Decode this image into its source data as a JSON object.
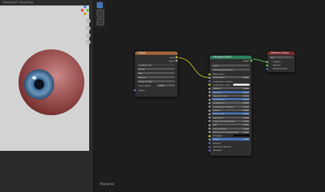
{
  "viewport": {
    "label": "Viewport Shading"
  },
  "image_node": {
    "title": "Image",
    "outputs": [
      "Color",
      "Alpha"
    ],
    "image_name": "ey_Basic_Iris.",
    "interpolation": "Linear",
    "projection": "Flat",
    "extension": "Repeat",
    "source": "Single Image",
    "color_space_label": "Color Space",
    "color_space": "sRGB",
    "vector_label": "Vector"
  },
  "bsdf_node": {
    "title": "Principled BSDF",
    "output": "BSDF",
    "distribution": "GGX",
    "subsurface_method": "Christensen-Burley",
    "inputs": [
      {
        "label": "Base Color"
      },
      {
        "label": "Subsurface",
        "value": "0.000"
      },
      {
        "label": "Subsurface Radius"
      },
      {
        "label": "Subsurface Color"
      },
      {
        "label": "Metallic",
        "value": "0.000"
      },
      {
        "label": "Specular",
        "value": "0.500",
        "highlight": true
      },
      {
        "label": "Specular Tint",
        "value": "0.000"
      },
      {
        "label": "Roughness",
        "value": "0.500",
        "highlight": true
      },
      {
        "label": "Anisotropic",
        "value": "0.000"
      },
      {
        "label": "Anisotropic Rotation",
        "value": "0.000"
      },
      {
        "label": "Sheen",
        "value": "0.000"
      },
      {
        "label": "Sheen Tint",
        "value": "0.500",
        "highlight": true
      },
      {
        "label": "Clearcoat",
        "value": "0.000"
      },
      {
        "label": "Clearcoat Roughness",
        "value": "0.030"
      },
      {
        "label": "IOR",
        "value": "1.450"
      },
      {
        "label": "Transmission",
        "value": "0.000"
      },
      {
        "label": "Transmission Roughness",
        "value": "0.000"
      },
      {
        "label": "Emission"
      },
      {
        "label": "Alpha",
        "value": "1.000",
        "highlight": true
      },
      {
        "label": "Normal"
      },
      {
        "label": "Clearcoat Normal"
      },
      {
        "label": "Tangent"
      }
    ]
  },
  "output_node": {
    "title": "Material Output",
    "target": "All",
    "inputs": [
      "Surface",
      "Volume",
      "Displacement"
    ]
  },
  "footer": {
    "text": "Material"
  },
  "colors": {
    "image_header": "#a0653a",
    "bsdf_header": "#2e7f5b",
    "output_header": "#7a2b2b",
    "socket_yellow": "#c7c729",
    "socket_gray": "#a1a1a1",
    "socket_purple": "#6363c7",
    "socket_green": "#63c763"
  }
}
